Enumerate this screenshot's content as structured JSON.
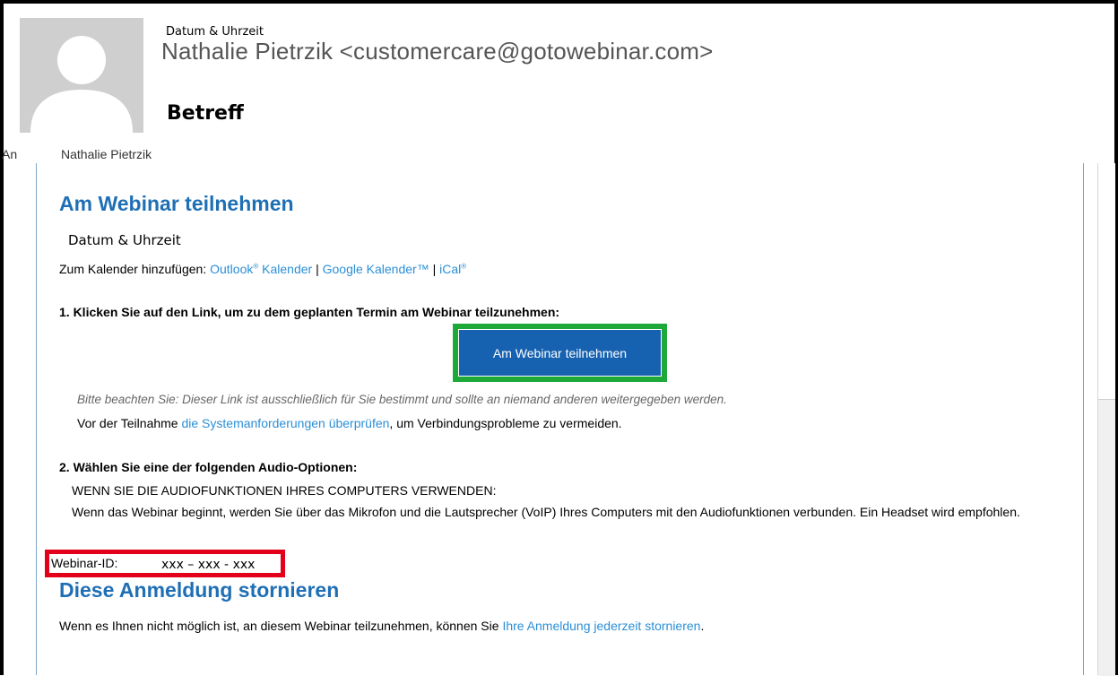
{
  "header": {
    "date_time": "Datum & Uhrzeit",
    "sender": "Nathalie Pietrzik <customercare@gotowebinar.com>",
    "subject": "Betreff",
    "to_label": "An",
    "to_name": "Nathalie Pietrzik"
  },
  "body": {
    "join_heading": "Am Webinar teilnehmen",
    "date_time": "Datum & Uhrzeit",
    "calendar_prefix": "Zum Kalender hinzufügen: ",
    "calendar_outlook": "Outlook",
    "calendar_outlook_mark": "®",
    "calendar_outlook_suffix": " Kalender",
    "calendar_google": "Google Kalender™",
    "calendar_ical": "iCal",
    "calendar_ical_mark": "®",
    "separator": " | ",
    "step1": "1. Klicken Sie auf den Link, um zu dem geplanten Termin am Webinar teilzunehmen:",
    "join_button": "Am Webinar teilnehmen",
    "note": "Bitte beachten Sie: Dieser Link ist ausschließlich für Sie bestimmt und sollte an niemand anderen weitergegeben werden.",
    "requirements_prefix": "Vor der Teilnahme ",
    "requirements_link": "die Systemanforderungen überprüfen",
    "requirements_suffix": ", um Verbindungsprobleme zu vermeiden.",
    "step2": "2. Wählen Sie eine der folgenden Audio-Optionen:",
    "audio_heading": "WENN SIE DIE AUDIOFUNKTIONEN IHRES COMPUTERS VERWENDEN:",
    "audio_text": "Wenn das Webinar beginnt, werden Sie über das Mikrofon und die Lautsprecher (VoIP) Ihres Computers mit den Audiofunktionen verbunden. Ein Headset wird empfohlen.",
    "webinar_id_label": "Webinar-ID:",
    "webinar_id_value": "xxx – xxx - xxx",
    "cancel_heading": "Diese Anmeldung stornieren",
    "cancel_prefix": "Wenn es Ihnen nicht möglich ist, an diesem Webinar teilzunehmen, können Sie ",
    "cancel_link": "Ihre Anmeldung jederzeit stornieren",
    "cancel_suffix": "."
  },
  "colors": {
    "link": "#2a8fd6",
    "heading": "#1f6fb5",
    "button": "#1662b0",
    "green_highlight": "#1fa83a",
    "red_highlight": "#e3001b"
  }
}
